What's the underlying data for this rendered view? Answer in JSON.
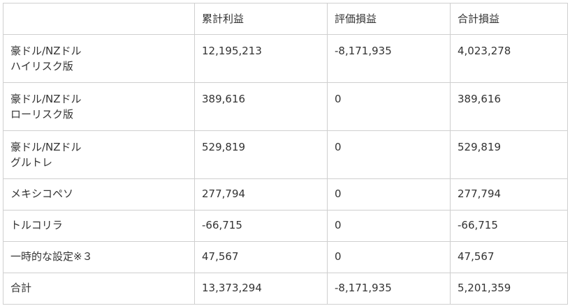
{
  "table": {
    "headers": [
      "",
      "累計利益",
      "評価損益",
      "合計損益"
    ],
    "rows": [
      {
        "label_lines": [
          "豪ドル/NZドル",
          "ハイリスク版"
        ],
        "cumulative": "12,195,213",
        "unrealized": "-8,171,935",
        "total": "4,023,278"
      },
      {
        "label_lines": [
          "豪ドル/NZドル",
          "ローリスク版"
        ],
        "cumulative": "389,616",
        "unrealized": "0",
        "total": "389,616"
      },
      {
        "label_lines": [
          "豪ドル/NZドル",
          "グルトレ"
        ],
        "cumulative": "529,819",
        "unrealized": "0",
        "total": "529,819"
      },
      {
        "label_lines": [
          "メキシコペソ"
        ],
        "cumulative": "277,794",
        "unrealized": "0",
        "total": "277,794"
      },
      {
        "label_lines": [
          "トルコリラ"
        ],
        "cumulative": "-66,715",
        "unrealized": "0",
        "total": "-66,715"
      },
      {
        "label_lines": [
          "一時的な設定※３"
        ],
        "cumulative": "47,567",
        "unrealized": "0",
        "total": "47,567"
      },
      {
        "label_lines": [
          "合計"
        ],
        "cumulative": "13,373,294",
        "unrealized": "-8,171,935",
        "total": "5,201,359"
      }
    ]
  }
}
